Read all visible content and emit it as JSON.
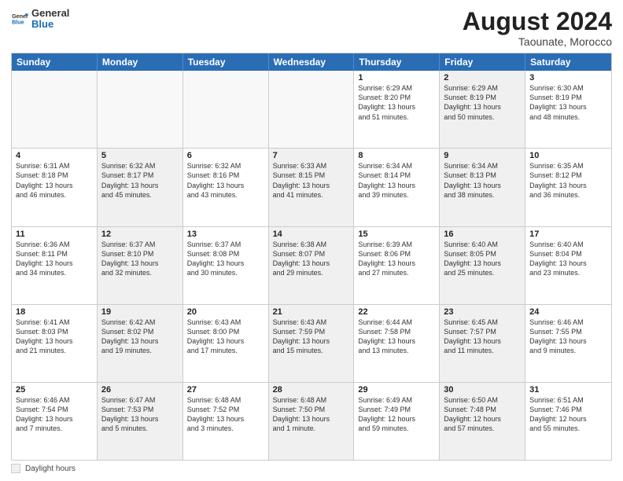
{
  "logo": {
    "general": "General",
    "blue": "Blue"
  },
  "header": {
    "month_year": "August 2024",
    "location": "Taounate, Morocco"
  },
  "weekdays": [
    "Sunday",
    "Monday",
    "Tuesday",
    "Wednesday",
    "Thursday",
    "Friday",
    "Saturday"
  ],
  "legend": {
    "label": "Daylight hours"
  },
  "weeks": [
    {
      "cells": [
        {
          "day": "",
          "info": "",
          "shaded": false,
          "empty": true
        },
        {
          "day": "",
          "info": "",
          "shaded": false,
          "empty": true
        },
        {
          "day": "",
          "info": "",
          "shaded": false,
          "empty": true
        },
        {
          "day": "",
          "info": "",
          "shaded": false,
          "empty": true
        },
        {
          "day": "1",
          "info": "Sunrise: 6:29 AM\nSunset: 8:20 PM\nDaylight: 13 hours\nand 51 minutes.",
          "shaded": false,
          "empty": false
        },
        {
          "day": "2",
          "info": "Sunrise: 6:29 AM\nSunset: 8:19 PM\nDaylight: 13 hours\nand 50 minutes.",
          "shaded": true,
          "empty": false
        },
        {
          "day": "3",
          "info": "Sunrise: 6:30 AM\nSunset: 8:19 PM\nDaylight: 13 hours\nand 48 minutes.",
          "shaded": false,
          "empty": false
        }
      ]
    },
    {
      "cells": [
        {
          "day": "4",
          "info": "Sunrise: 6:31 AM\nSunset: 8:18 PM\nDaylight: 13 hours\nand 46 minutes.",
          "shaded": false,
          "empty": false
        },
        {
          "day": "5",
          "info": "Sunrise: 6:32 AM\nSunset: 8:17 PM\nDaylight: 13 hours\nand 45 minutes.",
          "shaded": true,
          "empty": false
        },
        {
          "day": "6",
          "info": "Sunrise: 6:32 AM\nSunset: 8:16 PM\nDaylight: 13 hours\nand 43 minutes.",
          "shaded": false,
          "empty": false
        },
        {
          "day": "7",
          "info": "Sunrise: 6:33 AM\nSunset: 8:15 PM\nDaylight: 13 hours\nand 41 minutes.",
          "shaded": true,
          "empty": false
        },
        {
          "day": "8",
          "info": "Sunrise: 6:34 AM\nSunset: 8:14 PM\nDaylight: 13 hours\nand 39 minutes.",
          "shaded": false,
          "empty": false
        },
        {
          "day": "9",
          "info": "Sunrise: 6:34 AM\nSunset: 8:13 PM\nDaylight: 13 hours\nand 38 minutes.",
          "shaded": true,
          "empty": false
        },
        {
          "day": "10",
          "info": "Sunrise: 6:35 AM\nSunset: 8:12 PM\nDaylight: 13 hours\nand 36 minutes.",
          "shaded": false,
          "empty": false
        }
      ]
    },
    {
      "cells": [
        {
          "day": "11",
          "info": "Sunrise: 6:36 AM\nSunset: 8:11 PM\nDaylight: 13 hours\nand 34 minutes.",
          "shaded": false,
          "empty": false
        },
        {
          "day": "12",
          "info": "Sunrise: 6:37 AM\nSunset: 8:10 PM\nDaylight: 13 hours\nand 32 minutes.",
          "shaded": true,
          "empty": false
        },
        {
          "day": "13",
          "info": "Sunrise: 6:37 AM\nSunset: 8:08 PM\nDaylight: 13 hours\nand 30 minutes.",
          "shaded": false,
          "empty": false
        },
        {
          "day": "14",
          "info": "Sunrise: 6:38 AM\nSunset: 8:07 PM\nDaylight: 13 hours\nand 29 minutes.",
          "shaded": true,
          "empty": false
        },
        {
          "day": "15",
          "info": "Sunrise: 6:39 AM\nSunset: 8:06 PM\nDaylight: 13 hours\nand 27 minutes.",
          "shaded": false,
          "empty": false
        },
        {
          "day": "16",
          "info": "Sunrise: 6:40 AM\nSunset: 8:05 PM\nDaylight: 13 hours\nand 25 minutes.",
          "shaded": true,
          "empty": false
        },
        {
          "day": "17",
          "info": "Sunrise: 6:40 AM\nSunset: 8:04 PM\nDaylight: 13 hours\nand 23 minutes.",
          "shaded": false,
          "empty": false
        }
      ]
    },
    {
      "cells": [
        {
          "day": "18",
          "info": "Sunrise: 6:41 AM\nSunset: 8:03 PM\nDaylight: 13 hours\nand 21 minutes.",
          "shaded": false,
          "empty": false
        },
        {
          "day": "19",
          "info": "Sunrise: 6:42 AM\nSunset: 8:02 PM\nDaylight: 13 hours\nand 19 minutes.",
          "shaded": true,
          "empty": false
        },
        {
          "day": "20",
          "info": "Sunrise: 6:43 AM\nSunset: 8:00 PM\nDaylight: 13 hours\nand 17 minutes.",
          "shaded": false,
          "empty": false
        },
        {
          "day": "21",
          "info": "Sunrise: 6:43 AM\nSunset: 7:59 PM\nDaylight: 13 hours\nand 15 minutes.",
          "shaded": true,
          "empty": false
        },
        {
          "day": "22",
          "info": "Sunrise: 6:44 AM\nSunset: 7:58 PM\nDaylight: 13 hours\nand 13 minutes.",
          "shaded": false,
          "empty": false
        },
        {
          "day": "23",
          "info": "Sunrise: 6:45 AM\nSunset: 7:57 PM\nDaylight: 13 hours\nand 11 minutes.",
          "shaded": true,
          "empty": false
        },
        {
          "day": "24",
          "info": "Sunrise: 6:46 AM\nSunset: 7:55 PM\nDaylight: 13 hours\nand 9 minutes.",
          "shaded": false,
          "empty": false
        }
      ]
    },
    {
      "cells": [
        {
          "day": "25",
          "info": "Sunrise: 6:46 AM\nSunset: 7:54 PM\nDaylight: 13 hours\nand 7 minutes.",
          "shaded": false,
          "empty": false
        },
        {
          "day": "26",
          "info": "Sunrise: 6:47 AM\nSunset: 7:53 PM\nDaylight: 13 hours\nand 5 minutes.",
          "shaded": true,
          "empty": false
        },
        {
          "day": "27",
          "info": "Sunrise: 6:48 AM\nSunset: 7:52 PM\nDaylight: 13 hours\nand 3 minutes.",
          "shaded": false,
          "empty": false
        },
        {
          "day": "28",
          "info": "Sunrise: 6:48 AM\nSunset: 7:50 PM\nDaylight: 13 hours\nand 1 minute.",
          "shaded": true,
          "empty": false
        },
        {
          "day": "29",
          "info": "Sunrise: 6:49 AM\nSunset: 7:49 PM\nDaylight: 12 hours\nand 59 minutes.",
          "shaded": false,
          "empty": false
        },
        {
          "day": "30",
          "info": "Sunrise: 6:50 AM\nSunset: 7:48 PM\nDaylight: 12 hours\nand 57 minutes.",
          "shaded": true,
          "empty": false
        },
        {
          "day": "31",
          "info": "Sunrise: 6:51 AM\nSunset: 7:46 PM\nDaylight: 12 hours\nand 55 minutes.",
          "shaded": false,
          "empty": false
        }
      ]
    }
  ]
}
